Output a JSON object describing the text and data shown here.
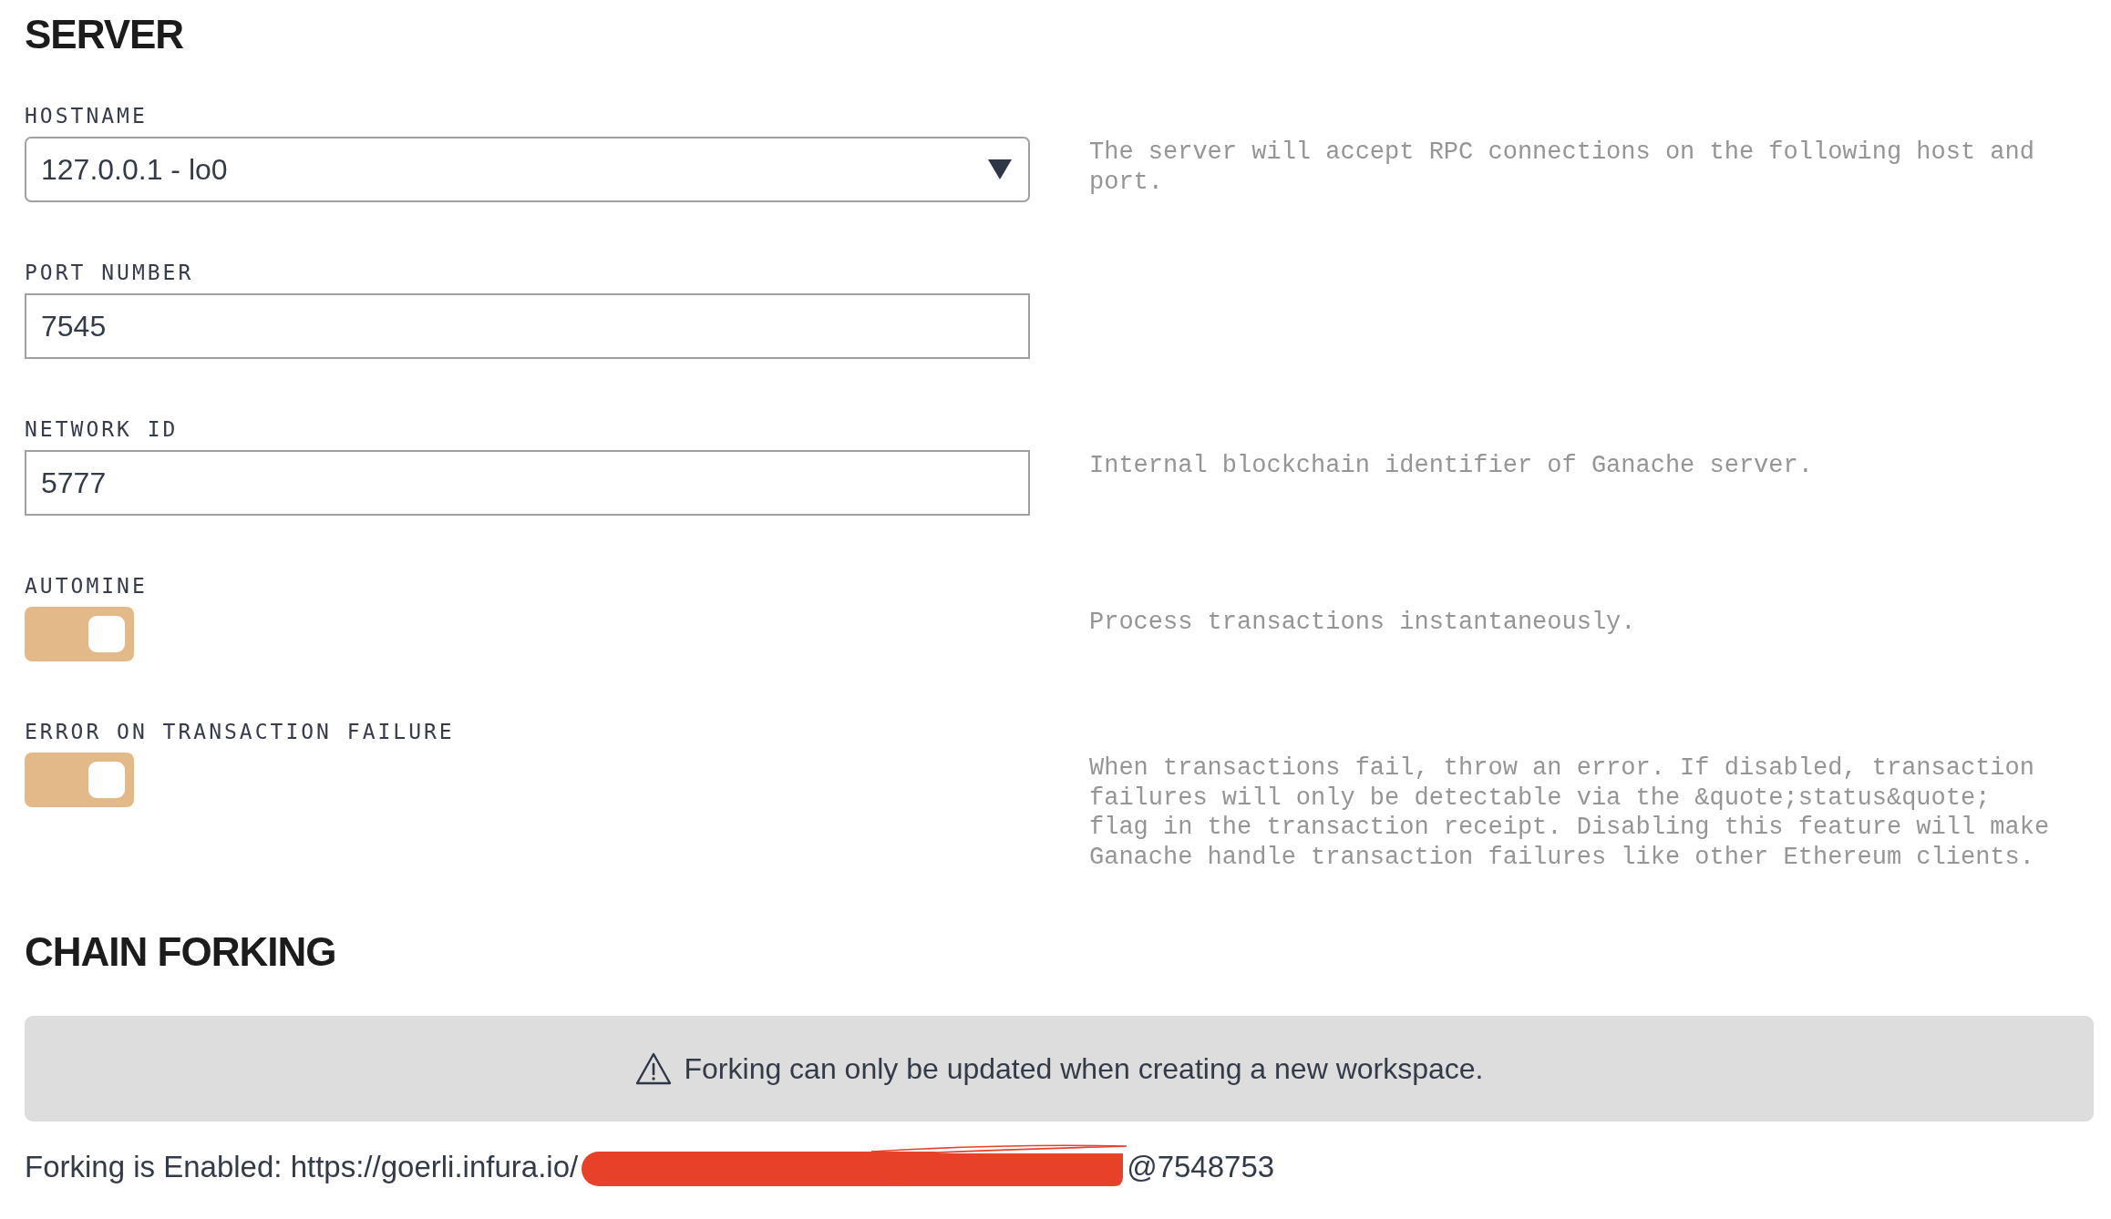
{
  "server": {
    "title": "SERVER",
    "settings": [
      {
        "kind": "select",
        "label": "HOSTNAME",
        "value": "127.0.0.1 - lo0",
        "description": "The server will accept RPC connections on the following host and port."
      },
      {
        "kind": "input",
        "label": "PORT NUMBER",
        "value": "7545"
      },
      {
        "kind": "input",
        "label": "NETWORK ID",
        "value": "5777",
        "description": "Internal blockchain identifier of Ganache server."
      },
      {
        "kind": "toggle",
        "label": "AUTOMINE",
        "on": true,
        "description": "Process transactions instantaneously."
      },
      {
        "kind": "toggle",
        "label": "ERROR ON TRANSACTION FAILURE",
        "on": true,
        "description": "When transactions fail, throw an error. If disabled, transaction failures will only be detectable via the &quote;status&quote; flag in the transaction receipt. Disabling this feature will make Ganache handle transaction failures like other Ethereum clients."
      }
    ]
  },
  "chain_forking": {
    "title": "CHAIN FORKING",
    "notice": "Forking can only be updated when creating a new workspace.",
    "status": "Forking is Enabled: https://goerli.infura.io/",
    "block": "@7548753"
  }
}
